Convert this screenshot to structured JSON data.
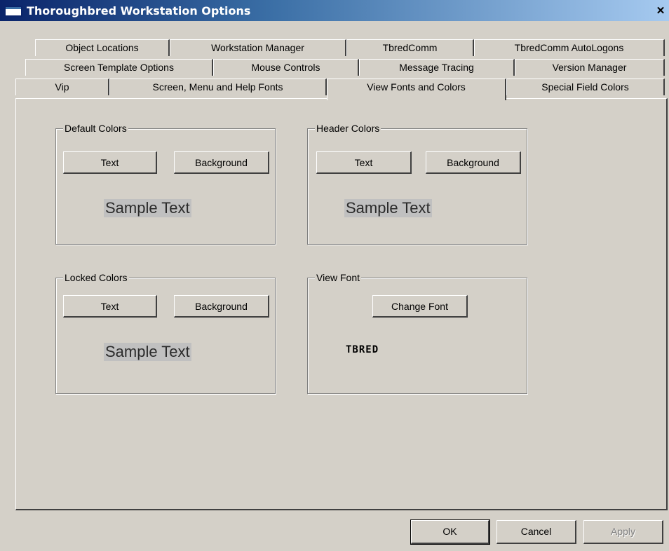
{
  "window": {
    "title": "Thoroughbred Workstation Options",
    "close_glyph": "✕"
  },
  "tabs": {
    "row1": [
      "Object Locations",
      "Workstation Manager",
      "TbredComm",
      "TbredComm AutoLogons"
    ],
    "row2": [
      "Screen Template Options",
      "Mouse Controls",
      "Message Tracing",
      "Version Manager"
    ],
    "row3": [
      "Vip",
      "Screen, Menu and Help Fonts",
      "View Fonts and Colors",
      "Special Field Colors"
    ],
    "active": "View Fonts and Colors"
  },
  "groups": {
    "default_colors": {
      "label": "Default Colors",
      "text_btn": "Text",
      "background_btn": "Background",
      "sample": "Sample Text"
    },
    "header_colors": {
      "label": "Header Colors",
      "text_btn": "Text",
      "background_btn": "Background",
      "sample": "Sample Text"
    },
    "locked_colors": {
      "label": "Locked Colors",
      "text_btn": "Text",
      "background_btn": "Background",
      "sample": "Sample Text"
    },
    "view_font": {
      "label": "View Font",
      "change_btn": "Change Font",
      "sample": "TBRED"
    }
  },
  "footer": {
    "ok": "OK",
    "cancel": "Cancel",
    "apply": "Apply"
  },
  "colors": {
    "face": "#d4d0c8",
    "title_start": "#0a246a",
    "title_end": "#a6caf0",
    "sample_bg": "#c0c0c0"
  }
}
